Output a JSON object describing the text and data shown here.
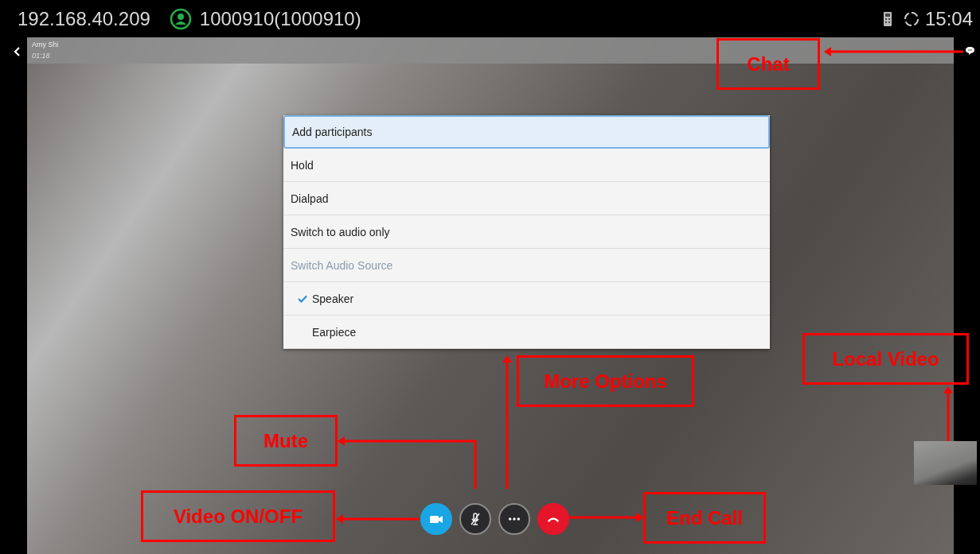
{
  "status_bar": {
    "ip": "192.168.40.209",
    "account": "1000910(1000910)",
    "time": "15:04"
  },
  "call": {
    "caller": "Amy Shi",
    "duration": "01:18"
  },
  "menu": [
    {
      "label": "Add participants",
      "kind": "action",
      "selected": true
    },
    {
      "label": "Hold",
      "kind": "action",
      "selected": false
    },
    {
      "label": "Dialpad",
      "kind": "action",
      "selected": false
    },
    {
      "label": "Switch to audio only",
      "kind": "action",
      "selected": false
    },
    {
      "label": "Switch Audio Source",
      "kind": "header",
      "selected": false
    },
    {
      "label": "Speaker",
      "kind": "option",
      "selected": false,
      "checked": true
    },
    {
      "label": "Earpiece",
      "kind": "option",
      "selected": false,
      "checked": false
    }
  ],
  "controls": [
    {
      "kind": "video",
      "on": true
    },
    {
      "kind": "mute",
      "on": false
    },
    {
      "kind": "more"
    },
    {
      "kind": "end"
    }
  ],
  "annotations": [
    {
      "kind": "chat",
      "label": "Chat"
    },
    {
      "kind": "local-video",
      "label": "Local Video"
    },
    {
      "kind": "more-options",
      "label": "More Options"
    },
    {
      "kind": "mute",
      "label": "Mute"
    },
    {
      "kind": "video",
      "label": "Video ON/OFF"
    },
    {
      "kind": "end-call",
      "label": "End Call"
    }
  ]
}
